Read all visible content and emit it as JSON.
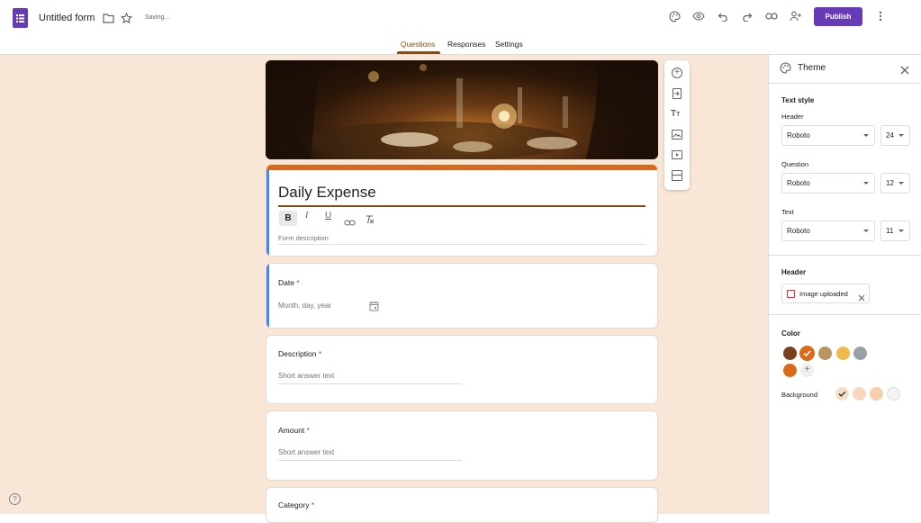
{
  "app": {
    "title": "Untitled form",
    "status": "Saving...",
    "publish_label": "Publish"
  },
  "tabs": [
    {
      "label": "Questions"
    },
    {
      "label": "Responses"
    },
    {
      "label": "Settings"
    }
  ],
  "form": {
    "title": "Daily Expense",
    "description_placeholder": "Form description",
    "questions": [
      {
        "label": "Date",
        "required_mark": "*",
        "placeholder": "Month, day, year"
      },
      {
        "label": "Description",
        "required_mark": "*",
        "placeholder": "Short answer text"
      },
      {
        "label": "Amount",
        "required_mark": "*",
        "placeholder": "Short answer text"
      },
      {
        "label": "Category",
        "required_mark": "*"
      }
    ]
  },
  "toolbar_format": [
    "bold",
    "italic",
    "underline",
    "link",
    "clear-format"
  ],
  "theme": {
    "title": "Theme",
    "text_style_label": "Text style",
    "header_label": "Header",
    "header_font": "Roboto",
    "header_size": "24",
    "question_label": "Question",
    "question_font": "Roboto",
    "question_size": "12",
    "text_label": "Text",
    "text_font": "Roboto",
    "text_size": "11",
    "header_section_label": "Header",
    "image_chip": "Image uploaded",
    "color_label": "Color",
    "background_label": "Background",
    "colors": [
      "#7b3f1e",
      "#d96a1c",
      "#b89560",
      "#efb94a",
      "#9aa0a6",
      "#d96a1c"
    ],
    "backgrounds": [
      "#f6dfc9",
      "#f8d8bd",
      "#f5cfae",
      "#f3f3f3"
    ]
  },
  "accent": "#d96a1c",
  "brand": "#673ab7"
}
